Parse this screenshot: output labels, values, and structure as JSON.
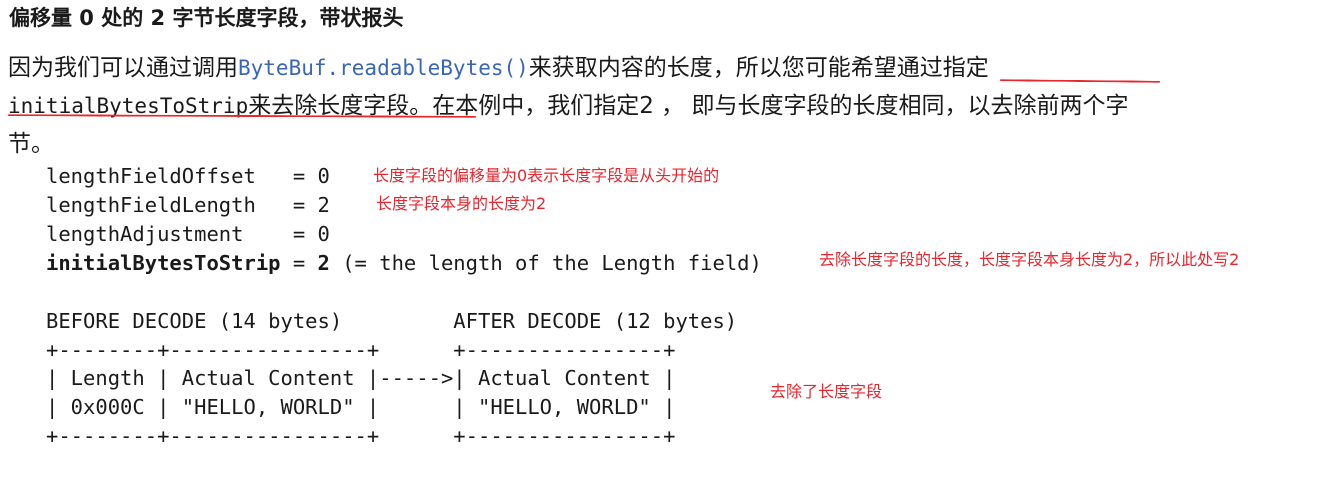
{
  "heading": "偏移量 0 处的 2 字节长度字段，带状报头",
  "paragraph": {
    "line1_a": "因为我们可以通过调用",
    "line1_code": "ByteBuf.readableBytes()",
    "line1_b": "来获取内容的长度，所以您可能希",
    "line1_c": "望通过指定",
    "line2_code": "initialBytesToStrip",
    "line2_a": "来去除长度字段。",
    "line2_b": "在本例中，我们指定2 ，  即与长度字段的长度相同，以去除前两个字",
    "line3": "节。"
  },
  "params": [
    {
      "text": "lengthFieldOffset   = 0",
      "note": "长度字段的偏移量为0表示长度字段是从头开始的"
    },
    {
      "text": "lengthFieldLength   = 2",
      "note": "长度字段本身的长度为2"
    },
    {
      "text": "lengthAdjustment    = 0",
      "note": ""
    },
    {
      "name": "initialBytesToStrip",
      "rest_a": " = ",
      "value": "2",
      "rest_b": " (= the length of the Length field)",
      "note": "去除长度字段的长度，长度字段本身长度为2，所以此处写2"
    }
  ],
  "diagram": {
    "line1": "BEFORE DECODE (14 bytes)         AFTER DECODE (12 bytes)",
    "line2": "+--------+----------------+      +----------------+",
    "line3": "| Length | Actual Content |----->| Actual Content |",
    "line4": "| 0x000C | \"HELLO, WORLD\" |      | \"HELLO, WORLD\" |",
    "line5": "+--------+----------------+      +----------------+",
    "note": "去除了长度字段"
  },
  "colors": {
    "code_inline": "#3a66b8",
    "annotation_red": "#e8262e"
  }
}
